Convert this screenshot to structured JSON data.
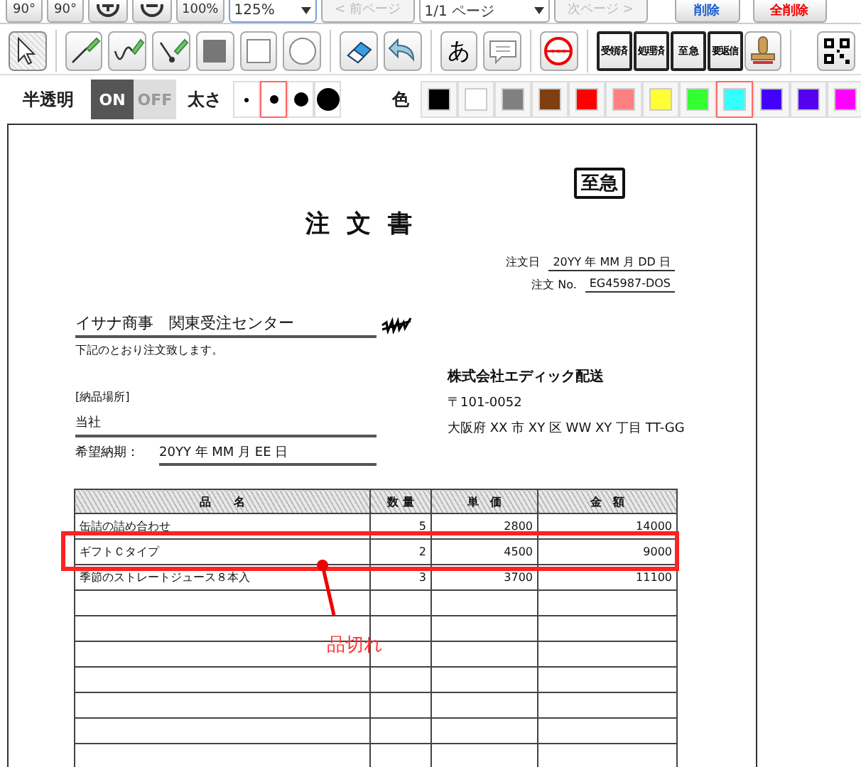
{
  "top_toolbar": [
    {
      "kind": "rotate_left",
      "label": "90°"
    },
    {
      "kind": "rotate_right",
      "label": "90°"
    },
    {
      "kind": "zoom_in"
    },
    {
      "kind": "zoom_out"
    },
    {
      "kind": "text",
      "label": "100%"
    },
    {
      "kind": "select",
      "label": "125%"
    },
    {
      "kind": "text",
      "label": "< 前ページ",
      "disabled": true
    },
    {
      "kind": "select",
      "label": "1/1 ページ"
    },
    {
      "kind": "text",
      "label": "次ページ >",
      "disabled": true
    },
    {
      "kind": "delete",
      "label": "削除"
    },
    {
      "kind": "delete_all",
      "label": "全削除"
    }
  ],
  "tools": [
    {
      "kind": "pointer",
      "selected": true
    },
    {
      "kind": "pen_line",
      "selected": false
    },
    {
      "kind": "pen_free",
      "selected": false
    },
    {
      "kind": "pen_dot",
      "selected": false
    },
    {
      "kind": "filled_square",
      "selected": false
    },
    {
      "kind": "square",
      "selected": false
    },
    {
      "kind": "circle",
      "selected": false
    },
    {
      "kind": "eraser",
      "selected": false
    },
    {
      "kind": "undo",
      "selected": false
    },
    {
      "kind": "text",
      "label": "あ",
      "selected": false
    },
    {
      "kind": "comment",
      "selected": false
    },
    {
      "kind": "red_stamp",
      "selected": false
    },
    {
      "kind": "stamp_text",
      "label": "受領済",
      "selected": false
    },
    {
      "kind": "stamp_text",
      "label": "処理済",
      "selected": false
    },
    {
      "kind": "stamp_text",
      "label": "至 急",
      "selected": false
    },
    {
      "kind": "stamp_text",
      "label": "要返信",
      "selected": false
    },
    {
      "kind": "seal",
      "selected": false
    },
    {
      "kind": "qr",
      "selected": false
    }
  ],
  "options": {
    "opacity_label": "半透明",
    "toggle": [
      {
        "label": "ON",
        "selected": true
      },
      {
        "label": "OFF",
        "selected": false
      }
    ],
    "width_label": "太さ",
    "widths": [
      {
        "selected": false
      },
      {
        "selected": true
      },
      {
        "selected": false
      },
      {
        "selected": false
      }
    ],
    "color_label": "色",
    "colors": [
      {
        "color": "#000000",
        "selected": false
      },
      {
        "color": "#ffffff",
        "selected": false
      },
      {
        "color": "#808080",
        "selected": false
      },
      {
        "color": "#7f3f10",
        "selected": false
      },
      {
        "color": "#ff0000",
        "selected": false
      },
      {
        "color": "#ff8080",
        "selected": false
      },
      {
        "color": "#ffff33",
        "selected": false
      },
      {
        "color": "#33ff33",
        "selected": false
      },
      {
        "color": "#33ffff",
        "selected": true
      },
      {
        "color": "#4400ff",
        "selected": false
      },
      {
        "color": "#5500ee",
        "selected": false
      },
      {
        "color": "#ff00ff",
        "selected": false
      }
    ]
  },
  "document": {
    "urgent_stamp": "至急",
    "title": "注 文 書",
    "order_date_label": "注文日",
    "order_date": "20YY 年 MM 月 DD 日",
    "order_no_label": "注文 No.",
    "order_no": "EG45987-DOS",
    "recipient": "イサナ商事　関東受注センター",
    "honorific_struck": true,
    "intro": "下記のとおり注文致します。",
    "delivery_label": "[納品場所]",
    "delivery_place": "当社",
    "due_label": "希望納期：",
    "due_date": "20YY 年 MM 月 EE 日",
    "sender_name": "株式会社エディック配送",
    "sender_zip": "〒101-0052",
    "sender_address": "大阪府 XX 市 XY 区 WW XY 丁目 TT-GG",
    "table": {
      "columns": [
        "品　　名",
        "数 量",
        "単　価",
        "金　額"
      ],
      "rows": [
        {
          "cells": [
            "缶詰の詰め合わせ",
            "5",
            "2800",
            "14000"
          ],
          "highlighted": false
        },
        {
          "cells": [
            "ギフトＣタイプ",
            "2",
            "4500",
            "9000"
          ],
          "highlighted": true
        },
        {
          "cells": [
            "季節のストレートジュース８本入",
            "3",
            "3700",
            "11100"
          ],
          "highlighted": false
        }
      ]
    },
    "annotation_label": "品切れ"
  }
}
